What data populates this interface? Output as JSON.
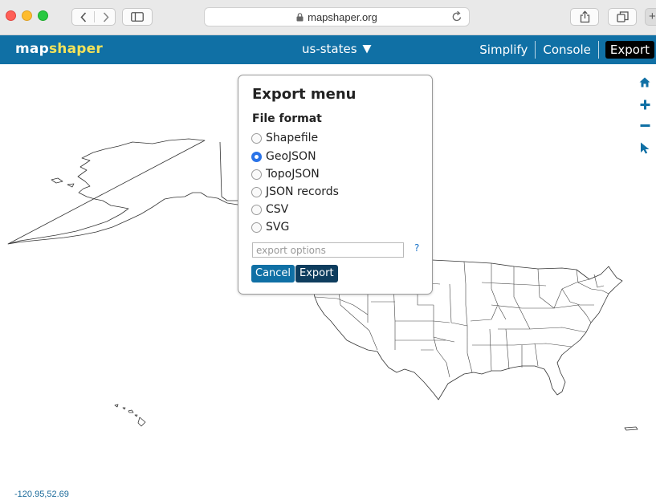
{
  "browser": {
    "url": "mapshaper.org",
    "new_tab_symbol": "+"
  },
  "app": {
    "logo_prefix": "map",
    "logo_suffix": "shaper",
    "layer_name": "us-states",
    "menu": {
      "simplify": "Simplify",
      "console": "Console",
      "export": "Export"
    }
  },
  "export_menu": {
    "title": "Export menu",
    "format_label": "File format",
    "formats": [
      {
        "label": "Shapefile",
        "selected": false
      },
      {
        "label": "GeoJSON",
        "selected": true
      },
      {
        "label": "TopoJSON",
        "selected": false
      },
      {
        "label": "JSON records",
        "selected": false
      },
      {
        "label": "CSV",
        "selected": false
      },
      {
        "label": "SVG",
        "selected": false
      }
    ],
    "options_placeholder": "export options",
    "help_symbol": "?",
    "cancel_label": "Cancel",
    "export_label": "Export"
  },
  "map": {
    "coordinates": "-120.95,52.69"
  },
  "colors": {
    "header": "#1070a5",
    "logo_accent": "#f2e25a",
    "active_tab": "#000000",
    "radio_selected": "#2a73e8",
    "cancel_button": "#1070a5",
    "export_button": "#0e3d5e",
    "tool_icons": "#1070a5"
  }
}
